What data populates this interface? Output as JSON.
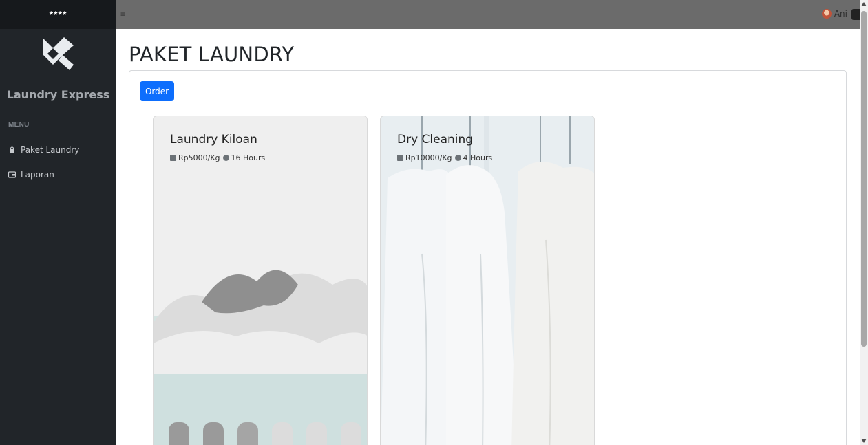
{
  "sidebar": {
    "top_label": "****",
    "brand": "Laundry Express",
    "menu_heading": "MENU",
    "items": [
      {
        "label": "Paket Laundry",
        "icon": "lock-icon"
      },
      {
        "label": "Laporan",
        "icon": "wallet-icon"
      }
    ]
  },
  "topbar": {
    "menu_icon": "hamburger-icon",
    "user_name": "Ani"
  },
  "main": {
    "title": "PAKET LAUNDRY",
    "order_label": "Order"
  },
  "cards": [
    {
      "title": "Laundry Kiloan",
      "price": "Rp5000/Kg",
      "duration": "16 Hours"
    },
    {
      "title": "Dry Cleaning",
      "price": "Rp10000/Kg",
      "duration": "4 Hours"
    }
  ],
  "colors": {
    "sidebar": "#212529",
    "topbar": "#6b6b6b",
    "primary": "#0d6efd"
  }
}
